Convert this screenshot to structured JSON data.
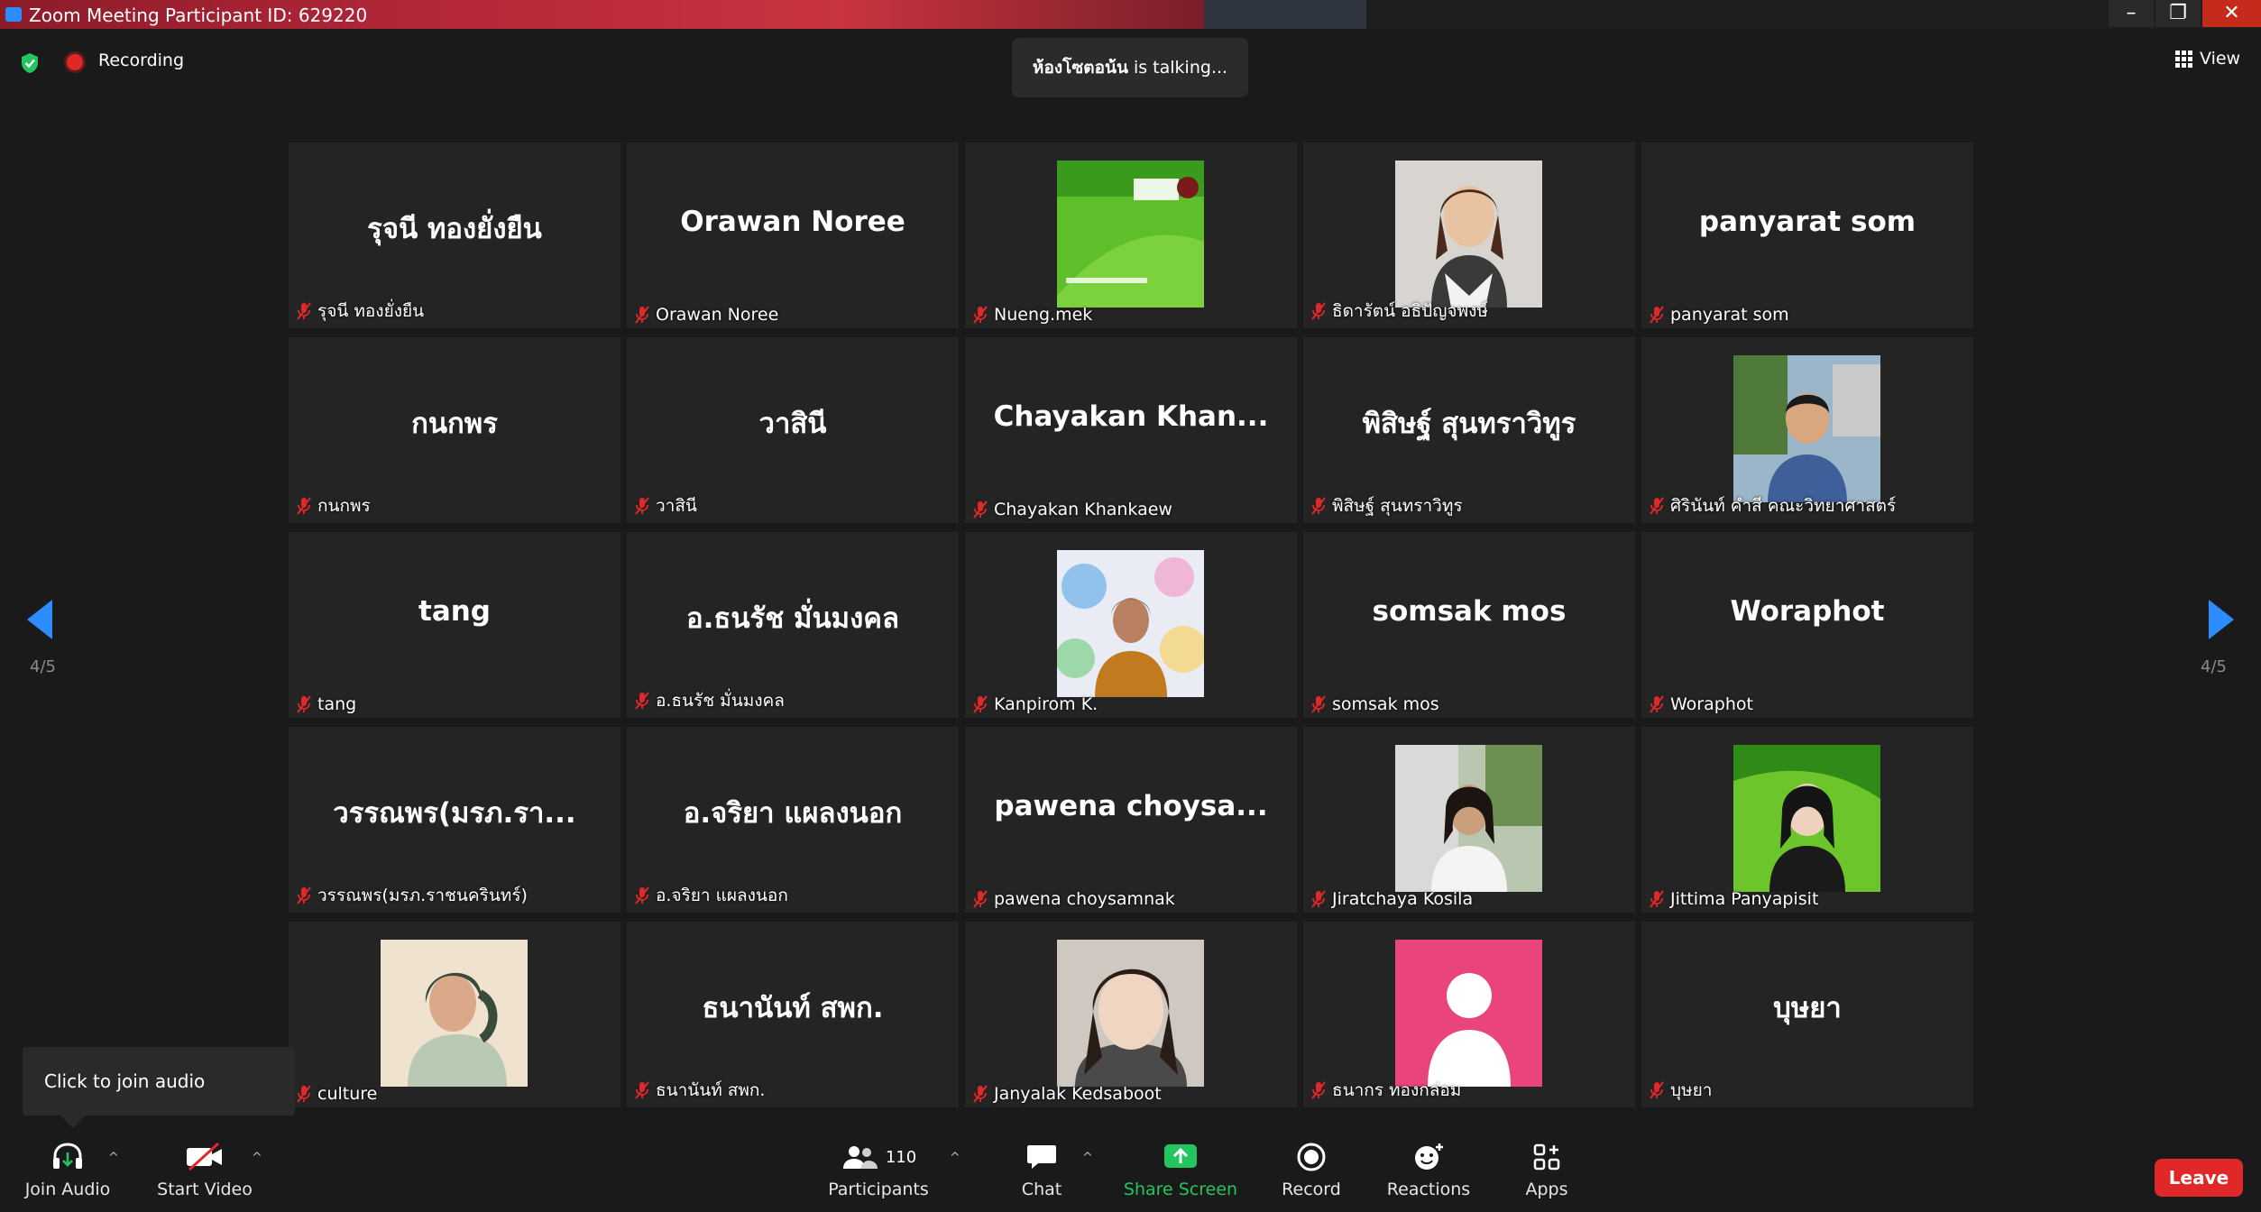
{
  "window": {
    "title": "Zoom Meeting Participant ID: 629220",
    "minimize": "–",
    "maximize": "❐",
    "close": "✕"
  },
  "status": {
    "recording_label": "Recording",
    "talking_name": "ห้องโซตอน้น",
    "talking_suffix": "is talking...",
    "view_label": "View"
  },
  "pager": {
    "left_page": "4/5",
    "right_page": "4/5"
  },
  "tiles": [
    {
      "big": "รุจนี ทองยั่งยืน",
      "label": "รุจนี ทองยั่งยืน"
    },
    {
      "big": "Orawan Noree",
      "label": "Orawan Noree"
    },
    {
      "big": "",
      "label": "Nueng.mek",
      "photo": "rru-banner"
    },
    {
      "big": "",
      "label": "ธิดารัตน์ อธิปัญจพงษ์",
      "photo": "woman-portrait"
    },
    {
      "big": "panyarat som",
      "label": "panyarat som"
    },
    {
      "big": "กนกพร",
      "label": "กนกพร"
    },
    {
      "big": "วาสินี",
      "label": "วาสินี"
    },
    {
      "big": "Chayakan  Khan...",
      "label": "Chayakan Khankaew"
    },
    {
      "big": "พิสิษฐ์ สุนทราวิทูร",
      "label": "พิสิษฐ์ สุนทราวิทูร"
    },
    {
      "big": "",
      "label": "ศิรินันท์ คำสี คณะวิทยาศาสตร์",
      "photo": "outdoor-man"
    },
    {
      "big": "tang",
      "label": "tang"
    },
    {
      "big": "อ.ธนรัช มั่นมงคล",
      "label": "อ.ธนรัช มั่นมงคล"
    },
    {
      "big": "",
      "label": "Kanpirom K.",
      "photo": "woman-colorwall"
    },
    {
      "big": "somsak  mos",
      "label": "somsak  mos"
    },
    {
      "big": "Woraphot",
      "label": "Woraphot"
    },
    {
      "big": "วรรณพร(มรภ.รา...",
      "label": "วรรณพร(มรภ.ราชนครินทร์)"
    },
    {
      "big": "อ.จริยา แผลงนอก",
      "label": "อ.จริยา แผลงนอก"
    },
    {
      "big": "pawena  choysa...",
      "label": "pawena choysamnak"
    },
    {
      "big": "",
      "label": "Jiratchaya Kosila",
      "photo": "woman-outdoor"
    },
    {
      "big": "",
      "label": "Jittima Panyapisit",
      "photo": "woman-green"
    },
    {
      "big": "",
      "label": "culture",
      "photo": "painting"
    },
    {
      "big": "ธนานันท์ สพก.",
      "label": "ธนานันท์ สพก."
    },
    {
      "big": "",
      "label": "Janyalak Kedsaboot",
      "photo": "woman-closeup"
    },
    {
      "big": "",
      "label": "ธนากร ทองกล่อม",
      "photo": "default-avatar"
    },
    {
      "big": "บุษยา",
      "label": "บุษยา"
    }
  ],
  "tooltip": {
    "join_audio": "Click to join audio"
  },
  "toolbar": {
    "join_audio": "Join Audio",
    "start_video": "Start Video",
    "participants": "Participants",
    "participant_count": "110",
    "chat": "Chat",
    "share_screen": "Share Screen",
    "record": "Record",
    "reactions": "Reactions",
    "apps": "Apps",
    "leave": "Leave"
  },
  "colors": {
    "accent": "#2d8cff",
    "share": "#22c55e",
    "leave": "#e02828",
    "tile": "#242424"
  }
}
